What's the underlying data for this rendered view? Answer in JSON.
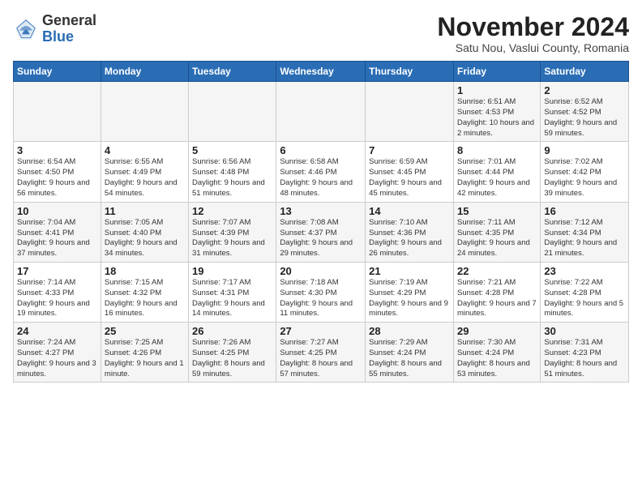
{
  "logo": {
    "general": "General",
    "blue": "Blue"
  },
  "header": {
    "month": "November 2024",
    "location": "Satu Nou, Vaslui County, Romania"
  },
  "weekdays": [
    "Sunday",
    "Monday",
    "Tuesday",
    "Wednesday",
    "Thursday",
    "Friday",
    "Saturday"
  ],
  "weeks": [
    [
      {
        "day": "",
        "info": ""
      },
      {
        "day": "",
        "info": ""
      },
      {
        "day": "",
        "info": ""
      },
      {
        "day": "",
        "info": ""
      },
      {
        "day": "",
        "info": ""
      },
      {
        "day": "1",
        "info": "Sunrise: 6:51 AM\nSunset: 4:53 PM\nDaylight: 10 hours and 2 minutes."
      },
      {
        "day": "2",
        "info": "Sunrise: 6:52 AM\nSunset: 4:52 PM\nDaylight: 9 hours and 59 minutes."
      }
    ],
    [
      {
        "day": "3",
        "info": "Sunrise: 6:54 AM\nSunset: 4:50 PM\nDaylight: 9 hours and 56 minutes."
      },
      {
        "day": "4",
        "info": "Sunrise: 6:55 AM\nSunset: 4:49 PM\nDaylight: 9 hours and 54 minutes."
      },
      {
        "day": "5",
        "info": "Sunrise: 6:56 AM\nSunset: 4:48 PM\nDaylight: 9 hours and 51 minutes."
      },
      {
        "day": "6",
        "info": "Sunrise: 6:58 AM\nSunset: 4:46 PM\nDaylight: 9 hours and 48 minutes."
      },
      {
        "day": "7",
        "info": "Sunrise: 6:59 AM\nSunset: 4:45 PM\nDaylight: 9 hours and 45 minutes."
      },
      {
        "day": "8",
        "info": "Sunrise: 7:01 AM\nSunset: 4:44 PM\nDaylight: 9 hours and 42 minutes."
      },
      {
        "day": "9",
        "info": "Sunrise: 7:02 AM\nSunset: 4:42 PM\nDaylight: 9 hours and 39 minutes."
      }
    ],
    [
      {
        "day": "10",
        "info": "Sunrise: 7:04 AM\nSunset: 4:41 PM\nDaylight: 9 hours and 37 minutes."
      },
      {
        "day": "11",
        "info": "Sunrise: 7:05 AM\nSunset: 4:40 PM\nDaylight: 9 hours and 34 minutes."
      },
      {
        "day": "12",
        "info": "Sunrise: 7:07 AM\nSunset: 4:39 PM\nDaylight: 9 hours and 31 minutes."
      },
      {
        "day": "13",
        "info": "Sunrise: 7:08 AM\nSunset: 4:37 PM\nDaylight: 9 hours and 29 minutes."
      },
      {
        "day": "14",
        "info": "Sunrise: 7:10 AM\nSunset: 4:36 PM\nDaylight: 9 hours and 26 minutes."
      },
      {
        "day": "15",
        "info": "Sunrise: 7:11 AM\nSunset: 4:35 PM\nDaylight: 9 hours and 24 minutes."
      },
      {
        "day": "16",
        "info": "Sunrise: 7:12 AM\nSunset: 4:34 PM\nDaylight: 9 hours and 21 minutes."
      }
    ],
    [
      {
        "day": "17",
        "info": "Sunrise: 7:14 AM\nSunset: 4:33 PM\nDaylight: 9 hours and 19 minutes."
      },
      {
        "day": "18",
        "info": "Sunrise: 7:15 AM\nSunset: 4:32 PM\nDaylight: 9 hours and 16 minutes."
      },
      {
        "day": "19",
        "info": "Sunrise: 7:17 AM\nSunset: 4:31 PM\nDaylight: 9 hours and 14 minutes."
      },
      {
        "day": "20",
        "info": "Sunrise: 7:18 AM\nSunset: 4:30 PM\nDaylight: 9 hours and 11 minutes."
      },
      {
        "day": "21",
        "info": "Sunrise: 7:19 AM\nSunset: 4:29 PM\nDaylight: 9 hours and 9 minutes."
      },
      {
        "day": "22",
        "info": "Sunrise: 7:21 AM\nSunset: 4:28 PM\nDaylight: 9 hours and 7 minutes."
      },
      {
        "day": "23",
        "info": "Sunrise: 7:22 AM\nSunset: 4:28 PM\nDaylight: 9 hours and 5 minutes."
      }
    ],
    [
      {
        "day": "24",
        "info": "Sunrise: 7:24 AM\nSunset: 4:27 PM\nDaylight: 9 hours and 3 minutes."
      },
      {
        "day": "25",
        "info": "Sunrise: 7:25 AM\nSunset: 4:26 PM\nDaylight: 9 hours and 1 minute."
      },
      {
        "day": "26",
        "info": "Sunrise: 7:26 AM\nSunset: 4:25 PM\nDaylight: 8 hours and 59 minutes."
      },
      {
        "day": "27",
        "info": "Sunrise: 7:27 AM\nSunset: 4:25 PM\nDaylight: 8 hours and 57 minutes."
      },
      {
        "day": "28",
        "info": "Sunrise: 7:29 AM\nSunset: 4:24 PM\nDaylight: 8 hours and 55 minutes."
      },
      {
        "day": "29",
        "info": "Sunrise: 7:30 AM\nSunset: 4:24 PM\nDaylight: 8 hours and 53 minutes."
      },
      {
        "day": "30",
        "info": "Sunrise: 7:31 AM\nSunset: 4:23 PM\nDaylight: 8 hours and 51 minutes."
      }
    ]
  ]
}
